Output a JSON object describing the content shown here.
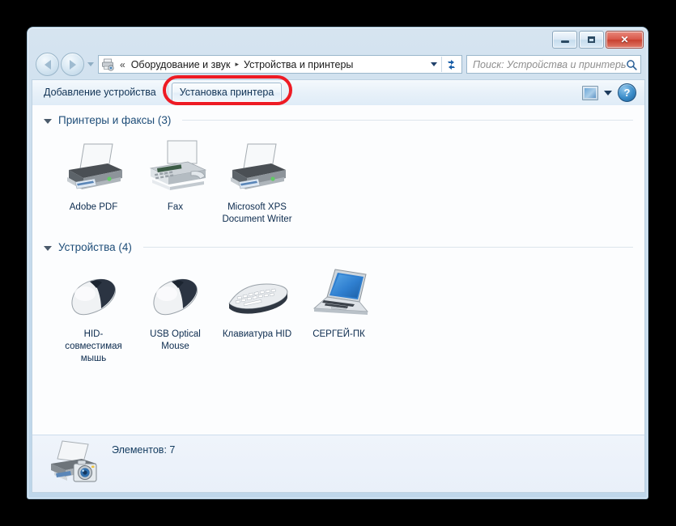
{
  "window": {
    "controls": {
      "minimize_label": "Свернуть",
      "maximize_label": "Развернуть",
      "close_label": "✕"
    }
  },
  "address_bar": {
    "icon": "devices-printers-icon",
    "overflow_chevrons": "«",
    "crumbs": [
      {
        "label": "Оборудование и звук"
      },
      {
        "label": "Устройства и принтеры"
      }
    ],
    "separator": "▸",
    "dropdown_icon": "chevron-down-icon",
    "refresh_icon": "refresh-icon",
    "refresh_glyph": "↻"
  },
  "search": {
    "placeholder": "Поиск: Устройства и принтеры",
    "icon": "search-icon"
  },
  "toolbar": {
    "add_device_label": "Добавление устройства",
    "install_printer_label": "Установка принтера",
    "view_icon": "preview-pane-icon",
    "view_chevron_icon": "chevron-down-icon",
    "help_label": "?",
    "help_icon": "help-icon"
  },
  "highlight": {
    "color": "#ee1b24",
    "target": "install-printer-button"
  },
  "groups": [
    {
      "title": "Принтеры и факсы (3)",
      "items": [
        {
          "label": "Adobe PDF",
          "icon": "printer-icon",
          "badge": "default-printer-check-badge"
        },
        {
          "label": "Fax",
          "icon": "fax-icon",
          "badge": null
        },
        {
          "label": "Microsoft XPS Document Writer",
          "icon": "printer-icon",
          "badge": null
        }
      ]
    },
    {
      "title": "Устройства (4)",
      "items": [
        {
          "label": "HID-совместимая мышь",
          "icon": "mouse-icon",
          "badge": null
        },
        {
          "label": "USB Optical Mouse",
          "icon": "mouse-icon",
          "badge": null
        },
        {
          "label": "Клавиатура HID",
          "icon": "keyboard-icon",
          "badge": null
        },
        {
          "label": "СЕРГЕЙ-ПК",
          "icon": "laptop-icon",
          "badge": null
        }
      ]
    }
  ],
  "status_bar": {
    "icon": "devices-summary-icon",
    "text": "Элементов: 7"
  }
}
